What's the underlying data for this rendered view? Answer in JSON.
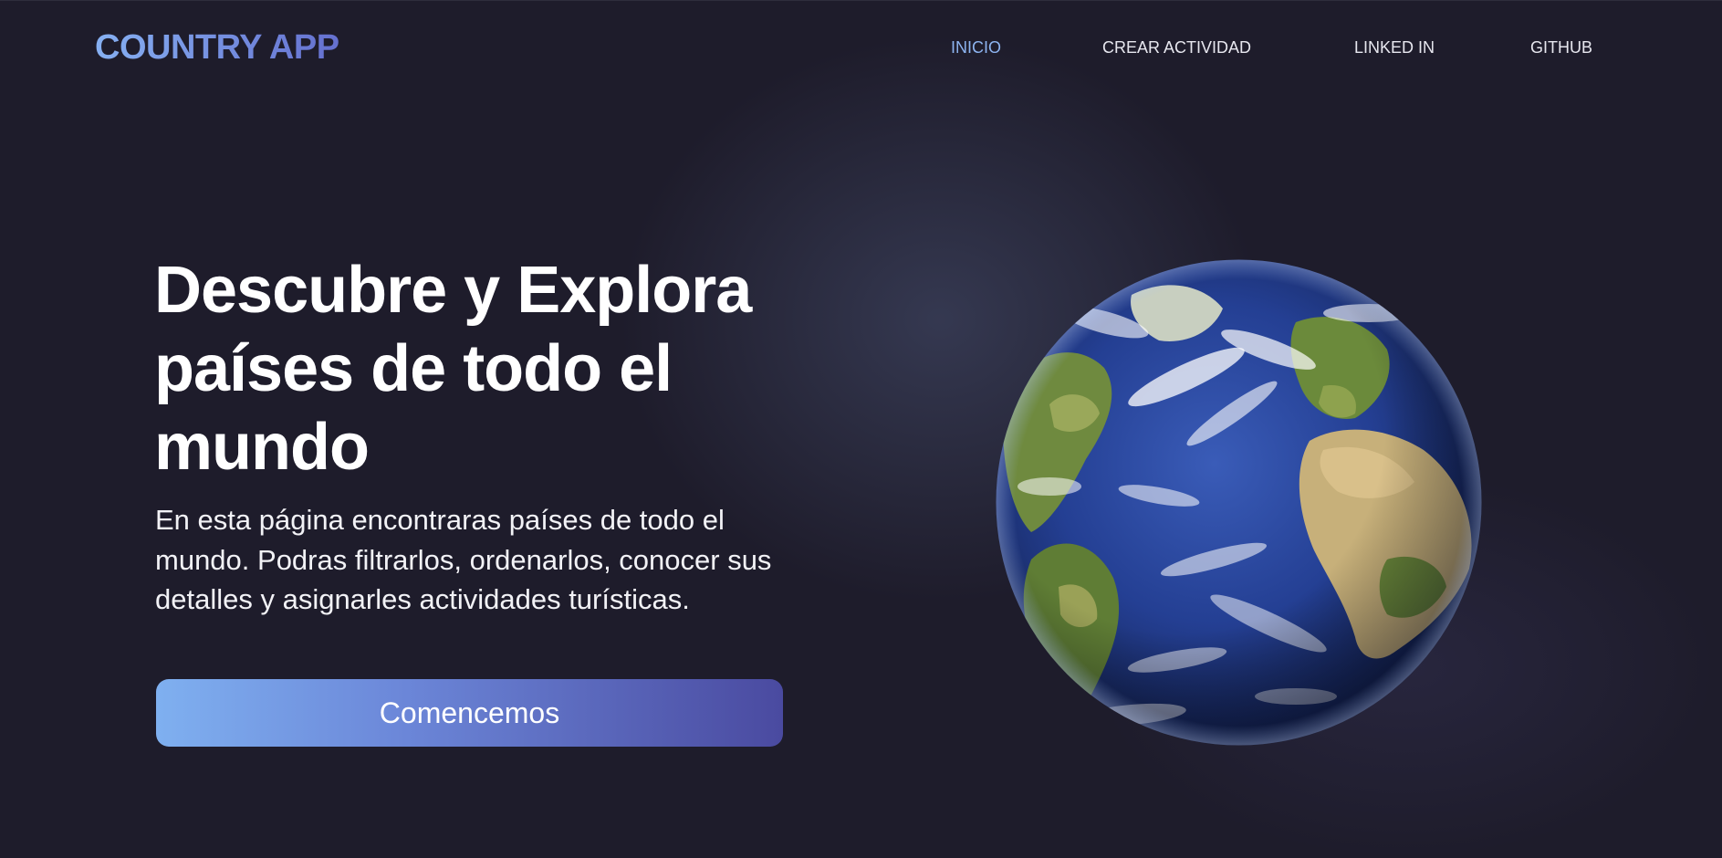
{
  "app": {
    "logo": "COUNTRY APP"
  },
  "nav": {
    "items": [
      {
        "label": "INICIO",
        "active": true
      },
      {
        "label": "CREAR ACTIVIDAD",
        "active": false
      },
      {
        "label": "LINKED IN",
        "active": false
      },
      {
        "label": "GITHUB",
        "active": false
      }
    ]
  },
  "hero": {
    "title": "Descubre y Explora países de todo el mundo",
    "description": "En esta página encontraras países de todo el mundo. Podras filtrarlos, ordenarlos, conocer sus detalles y asignarles actividades turísticas.",
    "cta_label": "Comencemos"
  },
  "colors": {
    "background": "#1e1c2b",
    "accent_light": "#86b0f2",
    "accent_dark": "#4a4aa0",
    "active_nav": "#8db4f0"
  },
  "icons": {
    "globe": "earth-globe-image"
  }
}
